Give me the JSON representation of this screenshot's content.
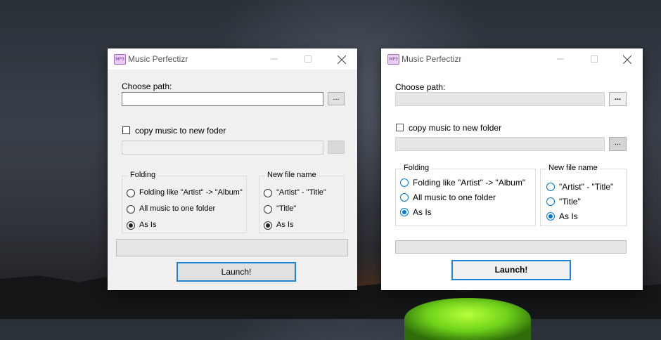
{
  "left_window": {
    "title": "Music Perfectizr",
    "icon_text": "MP3",
    "choose_path_label": "Choose path:",
    "path_value": "",
    "browse_label": "...",
    "copy_checkbox_label": "copy music to new foder",
    "copy_checkbox_checked": false,
    "dest_browse_label": "...",
    "folding": {
      "title": "Folding",
      "options": [
        "Folding like \"Artist\" -> \"Album\"",
        "All music to one folder",
        "As Is"
      ],
      "selected": 2
    },
    "new_file_name": {
      "title": "New file name",
      "options": [
        "\"Artist\" - \"Title\"",
        "\"Title\"",
        "As Is"
      ],
      "selected": 2
    },
    "launch_label": "Launch!"
  },
  "right_window": {
    "title": "Music Perfectizr",
    "icon_text": "MP3",
    "choose_path_label": "Choose path:",
    "path_value": "",
    "browse_label": "...",
    "copy_checkbox_label": "copy music to new folder",
    "copy_checkbox_checked": false,
    "dest_browse_label": "...",
    "folding": {
      "title": "Folding",
      "options": [
        "Folding like \"Artist\" -> \"Album\"",
        "All music to one folder",
        "As Is"
      ],
      "selected": 2
    },
    "new_file_name": {
      "title": "New file name",
      "options": [
        "\"Artist\" - \"Title\"",
        "\"Title\"",
        "As Is"
      ],
      "selected": 2
    },
    "launch_label": "Launch!"
  }
}
